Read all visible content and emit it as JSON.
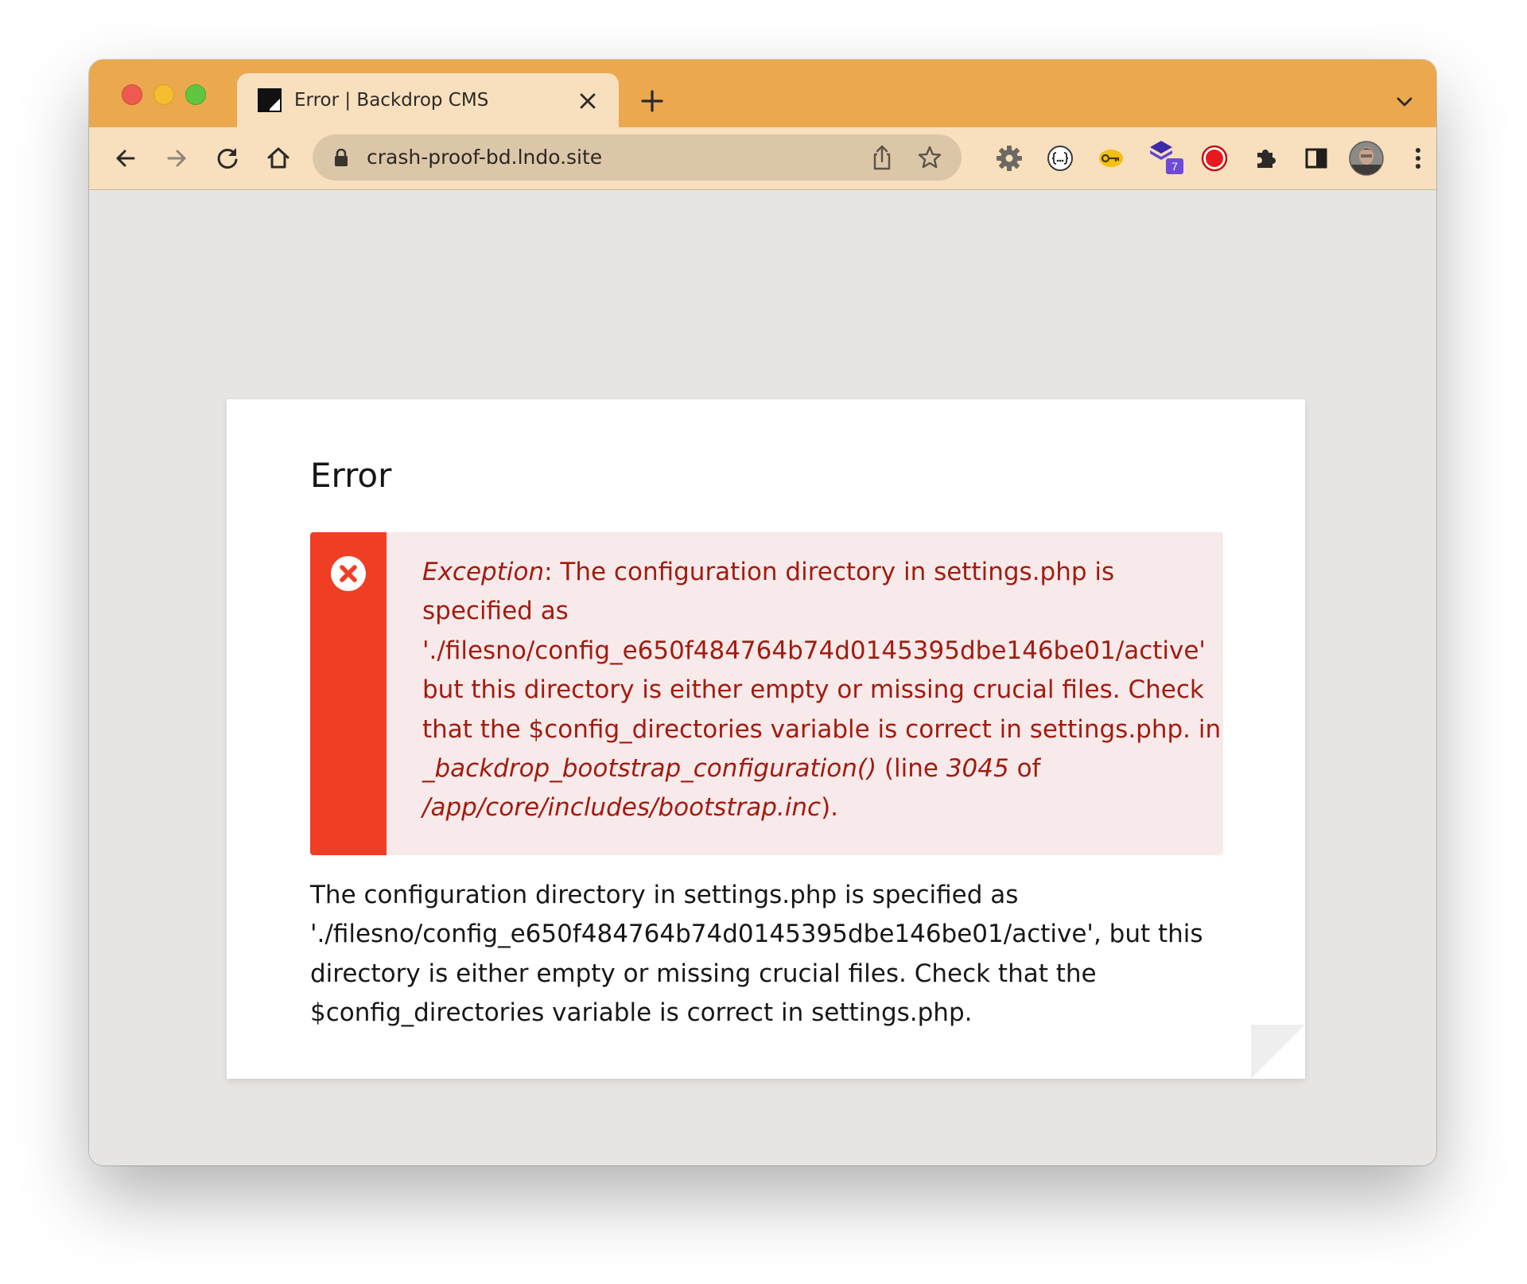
{
  "browser": {
    "tab": {
      "title": "Error | Backdrop CMS"
    },
    "address_bar": {
      "url": "crash-proof-bd.lndo.site"
    },
    "extensions": {
      "badge_count": "7"
    },
    "icons": [
      "back-icon",
      "forward-icon",
      "reload-icon",
      "home-icon",
      "lock-icon",
      "share-icon",
      "bookmark-star-icon",
      "gear-extension-icon",
      "json-extension-icon",
      "key-extension-icon",
      "stack-extension-icon",
      "record-extension-icon",
      "puzzle-extensions-icon",
      "side-panel-icon",
      "avatar",
      "kebab-menu-icon"
    ]
  },
  "page": {
    "heading": "Error",
    "alert": {
      "exception_label": "Exception",
      "colon": ": ",
      "message": "The configuration directory in settings.php is specified as './filesno/config_e650f484764b74d0145395dbe146be01/active' but this directory is either empty or missing crucial files. Check that the $config_directories variable is correct in settings.php. in ",
      "function": "_backdrop_bootstrap_configuration()",
      "line_prefix": " (line ",
      "line": "3045",
      "of": " of ",
      "file": "/app/core/includes/bootstrap.inc",
      "suffix": ")."
    },
    "message": "The configuration directory in settings.php is specified as './filesno/config_e650f484764b74d0145395dbe146be01/active', but this directory is either empty or missing crucial files. Check that the $config_directories variable is correct in settings.php."
  },
  "colors": {
    "titlebar": "#eba84d",
    "toolbar": "#f8dfbd",
    "alert_bar": "#ef3e24",
    "alert_background": "#f8eaea",
    "alert_text": "#a31b10"
  }
}
